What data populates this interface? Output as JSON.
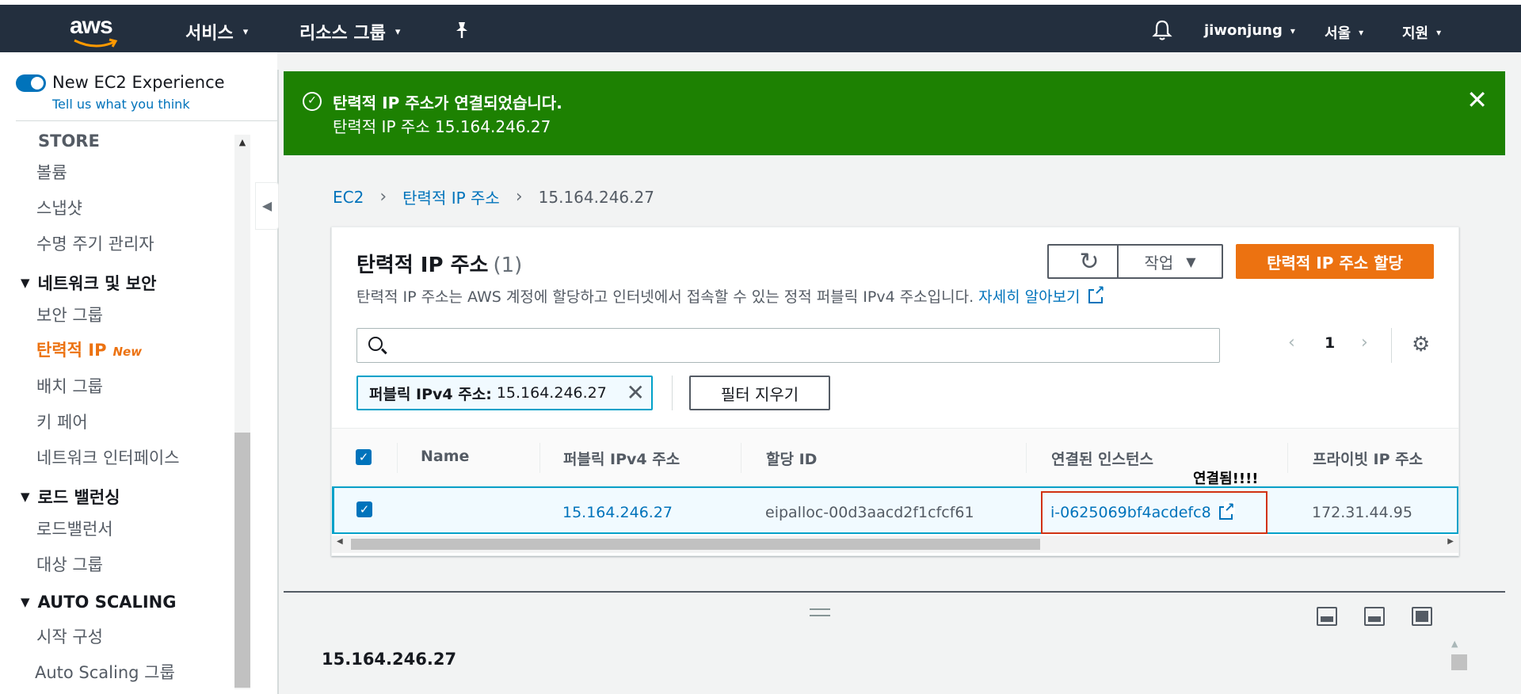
{
  "topbar": {
    "logo_text": "aws",
    "services": "서비스",
    "resource_groups": "리소스 그룹",
    "user": "jiwonjung",
    "region": "서울",
    "support": "지원",
    "chevron_down_icon": "▾",
    "bell_icon": "bell-icon",
    "pin_icon": "pin-icon"
  },
  "sidebar": {
    "toggle_label": "New EC2 Experience",
    "toggle_on": true,
    "feedback_link": "Tell us what you think",
    "sections": {
      "store": "STORE",
      "network": "네트워크 및 보안",
      "load_balancing": "로드 밸런싱",
      "auto_scaling": "AUTO SCALING"
    },
    "items": {
      "volumes": "볼륨",
      "snapshots": "스냅샷",
      "lifecycle": "수명 주기 관리자",
      "security_groups": "보안 그룹",
      "elastic_ip": "탄력적 IP",
      "elastic_ip_badge": "New",
      "placement_groups": "배치 그룹",
      "key_pairs": "키 페어",
      "network_interfaces": "네트워크 인터페이스",
      "load_balancers": "로드밸런서",
      "target_groups": "대상 그룹",
      "launch_configs": "시작 구성",
      "auto_scaling_groups": "Auto Scaling 그룹"
    }
  },
  "flash": {
    "title": "탄력적 IP 주소가 연결되었습니다.",
    "message": "탄력적 IP 주소 15.164.246.27",
    "check_icon": "✓",
    "close_icon": "✕",
    "color": "#1d8102"
  },
  "breadcrumb": {
    "root": "EC2",
    "parent": "탄력적 IP 주소",
    "current": "15.164.246.27",
    "separator": "›"
  },
  "panel": {
    "title": "탄력적 IP 주소",
    "count": "(1)",
    "description": "탄력적 IP 주소는 AWS 계정에 할당하고 인터넷에서 접속할 수 있는 정적 퍼블릭 IPv4 주소입니다.",
    "learn_more": "자세히 알아보기",
    "refresh_icon": "↻",
    "actions_label": "작업",
    "actions_caret": "▼",
    "allocate_label": "탄력적 IP 주소 할당",
    "accent_color": "#ec7211"
  },
  "search": {
    "placeholder": "",
    "value": ""
  },
  "pager": {
    "prev": "‹",
    "page": "1",
    "next": "›",
    "settings_icon": "⚙"
  },
  "filter": {
    "key": "퍼블릭 IPv4 주소:",
    "value": "15.164.246.27",
    "remove_icon": "✕",
    "clear_label": "필터 지우기"
  },
  "table": {
    "columns": [
      "Name",
      "퍼블릭 IPv4 주소",
      "할당 ID",
      "연결된 인스턴스",
      "프라이빗 IP 주소"
    ],
    "header_checked": true,
    "rows": [
      {
        "checked": true,
        "name": "",
        "public_ip": "15.164.246.27",
        "allocation_id": "eipalloc-00d3aacd2f1cfcf61",
        "instance": "i-0625069bf4acdefc8",
        "private_ip": "172.31.44.95"
      }
    ]
  },
  "annotation": "연결됨!!!!",
  "details": {
    "title": "15.164.246.27"
  }
}
